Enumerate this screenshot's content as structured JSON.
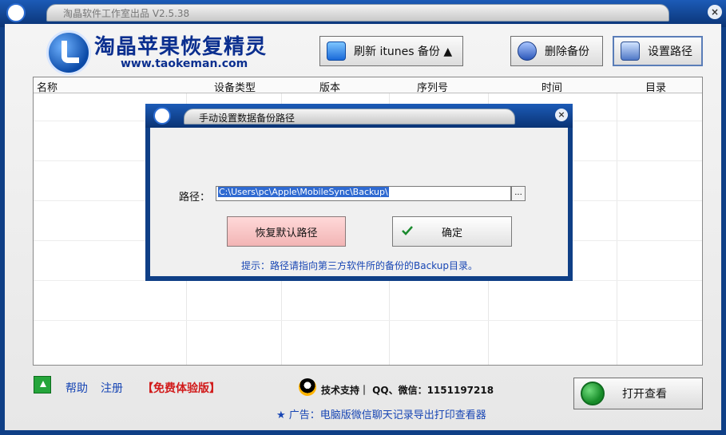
{
  "window": {
    "title": "淘晶软件工作室出品 V2.5.38",
    "close": "×"
  },
  "header": {
    "app_name": "淘晶苹果恢复精灵",
    "app_url": "www.taokeman.com",
    "buttons": {
      "refresh_itunes": "刷新 itunes 备份 ▲",
      "delete_backup": "删除备份",
      "set_path": "设置路径"
    }
  },
  "table": {
    "columns": [
      "名称",
      "设备类型",
      "版本",
      "序列号",
      "时间",
      "目录"
    ]
  },
  "dialog": {
    "title": "手动设置数据备份路径",
    "close": "×",
    "path_label": "路径：",
    "path_value": "C:\\Users\\pc\\Apple\\MobileSync\\Backup\\",
    "browse": "...",
    "restore_default": "恢复默认路径",
    "ok": "确定",
    "hint": "提示：路径请指向第三方软件所的备份的Backup目录。"
  },
  "footer": {
    "help": "帮助",
    "register": "注册",
    "trial": "【免费体验版】",
    "support": "技术支持｜ QQ、微信：1151197218",
    "ad": "★ 广告：电脑版微信聊天记录导出打印查看器",
    "open_viewer": "打开查看"
  }
}
